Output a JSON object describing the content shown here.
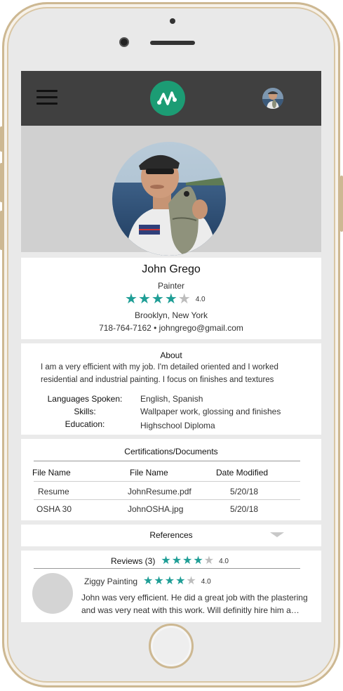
{
  "header": {
    "logo": "app-logo-icon",
    "menu_icon": "hamburger-menu-icon"
  },
  "profile": {
    "name": "John Grego",
    "title": "Painter",
    "rating": 4.0,
    "rating_label": "4.0",
    "location": "Brooklyn, New York",
    "contact": "718-764-7162 • johngrego@gmail.com"
  },
  "about": {
    "title": "About",
    "text": "I am a very efficient with my job. I'm detailed oriented and I worked residential and industrial painting. I focus on finishes and textures",
    "languages_label": "Languages Spoken:",
    "languages_value": "English, Spanish",
    "skills_label": "Skills:",
    "skills_value": "Wallpaper work, glossing  and finishes",
    "education_label": "Education:",
    "education_value": "Highschool Diploma"
  },
  "certifications": {
    "title": "Certifications/Documents",
    "columns": [
      "File Name",
      "File Name",
      "Date Modified"
    ],
    "rows": [
      [
        "Resume",
        "JohnResume.pdf",
        "5/20/18"
      ],
      [
        "OSHA 30",
        "JohnOSHA.jpg",
        "5/20/18"
      ]
    ]
  },
  "references": {
    "label": "References"
  },
  "reviews": {
    "title": "Reviews (3)",
    "rating": 4.0,
    "rating_label": "4.0",
    "items": [
      {
        "reviewer": "Ziggy Painting",
        "rating": 4.0,
        "rating_label": "4.0",
        "text": "John was very efficient. He did a great job with the plastering and was very neat with this work. Will definitly hire him a…"
      }
    ]
  },
  "colors": {
    "accent": "#1f9e96",
    "logo": "#1c9c74",
    "topbar": "#404040",
    "hero": "#d0d0d0"
  }
}
